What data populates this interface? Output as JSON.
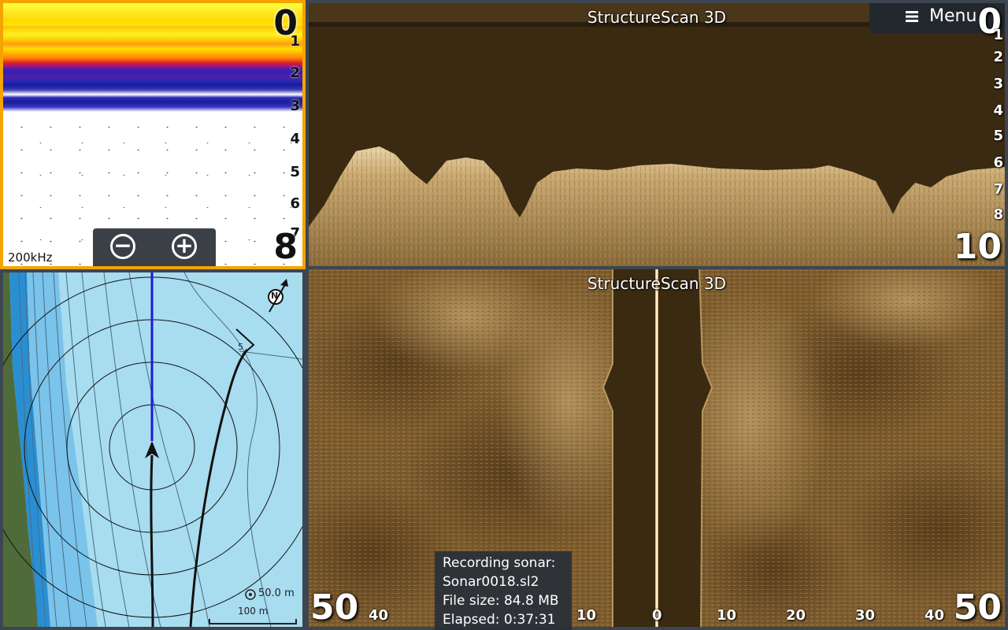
{
  "sonar_panel": {
    "frequency": "200kHz",
    "depth_top": "0",
    "depth_bottom": "8",
    "depth_ticks": [
      "1",
      "2",
      "3",
      "4",
      "5",
      "6",
      "7"
    ],
    "zoom_out_icon": "minus-circle-icon",
    "zoom_in_icon": "plus-circle-icon",
    "zoom_out_glyph": "−",
    "zoom_in_glyph": "+"
  },
  "top_scan": {
    "title": "StructureScan 3D",
    "depth_top": "0",
    "depth_bottom": "10",
    "depth_ticks": [
      "1",
      "2",
      "3",
      "4",
      "5",
      "6",
      "7",
      "8"
    ]
  },
  "menu": {
    "label": "Menu",
    "icon": "hamburger-icon"
  },
  "chart_panel": {
    "range_label": "50.0 m",
    "scale_label": "100 m",
    "north_label": "N",
    "contour_label": "5"
  },
  "bottom_scan": {
    "title": "StructureScan 3D",
    "range_left_big": "50",
    "range_right_big": "50",
    "range_ticks": [
      "40",
      "10",
      "0",
      "10",
      "20",
      "30",
      "40"
    ]
  },
  "recording": {
    "line1": "Recording sonar:",
    "line2": "Sonar0018.sl2",
    "line3": "File size:  84.8 MB",
    "line4": "Elapsed: 0:37:31"
  },
  "colors": {
    "sonar_border": "#f5a300",
    "scan_dark": "#3a2a12",
    "scan_light": "#c8a56a",
    "water": "#a8dcef",
    "heading_line": "#1a1ad8"
  }
}
